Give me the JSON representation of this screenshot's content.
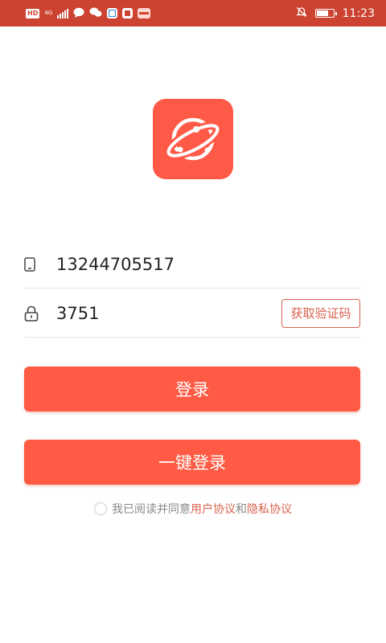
{
  "status_bar": {
    "badge_hd": "HD",
    "network": "4G",
    "time": "11:23",
    "colors": {
      "background": "#cc4431"
    },
    "icons": [
      "hd-icon",
      "signal-icon",
      "chat-icon",
      "wechat-icon",
      "app-icon",
      "book-icon",
      "news-icon",
      "mute-icon",
      "battery-icon"
    ]
  },
  "logo": {
    "icon": "planet-logo-icon",
    "color": "#ff5a47"
  },
  "login_form": {
    "phone": {
      "icon": "phone-icon",
      "value": "13244705517"
    },
    "code": {
      "icon": "lock-icon",
      "value": "3751",
      "get_code_label": "获取验证码"
    },
    "login_label": "登录",
    "one_key_login_label": "一键登录"
  },
  "agreement": {
    "prefix": "我已阅读并同意",
    "user_agreement": "用户协议",
    "conjunction": "和",
    "privacy_policy": "隐私协议"
  },
  "colors": {
    "accent": "#ff5a43",
    "link": "#d9614f"
  }
}
